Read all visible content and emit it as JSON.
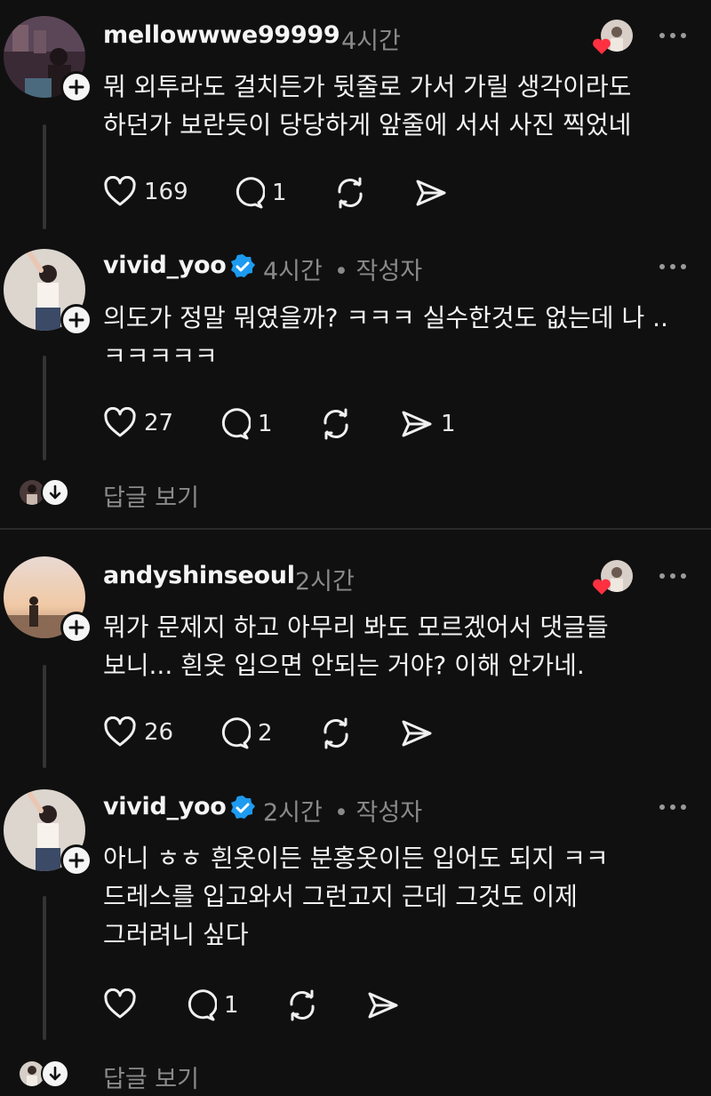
{
  "posts": [
    {
      "username": "mellowwwe99999",
      "time": "4시간",
      "author_tag": "",
      "lines": [
        "뭐 외투라도 걸치든가 뒷줄로 가서 가릴 생각이라도",
        "하던가 보란듯이 당당하게 앞줄에 서서 사진 찍었네"
      ],
      "likes": "169",
      "replies": "1",
      "reposts": "",
      "shares": ""
    },
    {
      "username": "vivid_yoo",
      "time": "4시간",
      "author_tag": "• 작성자",
      "lines": [
        "의도가 정말 뭐였을까? ㅋㅋㅋ 실수한것도 없는데 나 ..",
        "ㅋㅋㅋㅋㅋ"
      ],
      "likes": "27",
      "replies": "1",
      "reposts": "",
      "shares": "1"
    },
    {
      "username": "andyshinseoul",
      "time": "2시간",
      "author_tag": "",
      "lines": [
        "뭐가 문제지 하고 아무리 봐도 모르겠어서 댓글들",
        "보니... 흰옷 입으면 안되는 거야?  이해 안가네."
      ],
      "likes": "26",
      "replies": "2",
      "reposts": "",
      "shares": ""
    },
    {
      "username": "vivid_yoo",
      "time": "2시간",
      "author_tag": "• 작성자",
      "lines": [
        "아니 ㅎㅎ 흰옷이든 분홍옷이든 입어도 되지 ㅋㅋ",
        "드레스를 입고와서 그런고지 근데 그것도 이제",
        "그러려니 싶다"
      ],
      "likes": "",
      "replies": "1",
      "reposts": "",
      "shares": ""
    }
  ],
  "view_replies_label": "답글 보기",
  "icons": {
    "follow": "plus-icon",
    "verified": "verified-badge-icon",
    "more": "more-dots-icon",
    "like": "heart-icon",
    "reply": "comment-icon",
    "repost": "repost-icon",
    "share": "send-icon",
    "expand": "arrow-down-icon"
  },
  "colors": {
    "background": "#101010",
    "text": "#f3f3f3",
    "muted": "#8a8a8a",
    "verified": "#1d9bf0",
    "heart": "#ff3040"
  }
}
